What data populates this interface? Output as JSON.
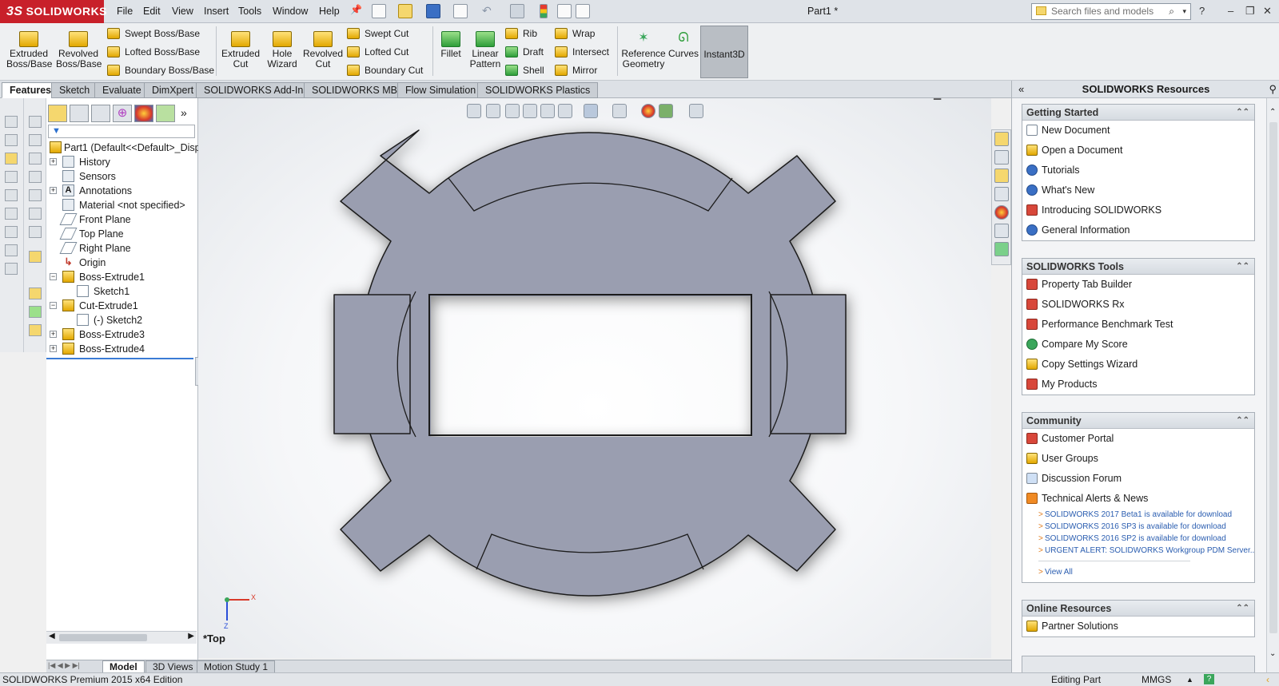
{
  "app": {
    "brand": "SOLIDWORKS",
    "brand_prefix": "3S",
    "doc_title": "Part1 *"
  },
  "menu": [
    "File",
    "Edit",
    "View",
    "Insert",
    "Tools",
    "Window",
    "Help"
  ],
  "search": {
    "placeholder": "Search files and models"
  },
  "window_buttons": {
    "help": "?",
    "minimize": "–",
    "restore": "❐",
    "close": "✕"
  },
  "ribbon": {
    "extruded_boss": "Extruded Boss/Base",
    "revolved_boss": "Revolved Boss/Base",
    "swept_boss": "Swept Boss/Base",
    "lofted_boss": "Lofted Boss/Base",
    "boundary_boss": "Boundary Boss/Base",
    "extruded_cut": "Extruded Cut",
    "hole_wizard": "Hole Wizard",
    "revolved_cut": "Revolved Cut",
    "swept_cut": "Swept Cut",
    "lofted_cut": "Lofted Cut",
    "boundary_cut": "Boundary Cut",
    "fillet": "Fillet",
    "linear_pattern": "Linear Pattern",
    "rib": "Rib",
    "draft": "Draft",
    "shell": "Shell",
    "wrap": "Wrap",
    "intersect": "Intersect",
    "mirror": "Mirror",
    "reference_geometry": "Reference Geometry",
    "curves": "Curves",
    "instant3d": "Instant3D"
  },
  "tabs": [
    "Features",
    "Sketch",
    "Evaluate",
    "DimXpert",
    "SOLIDWORKS Add-Ins",
    "SOLIDWORKS MBD",
    "Flow Simulation",
    "SOLIDWORKS Plastics"
  ],
  "tree": {
    "root": "Part1  (Default<<Default>_Disp",
    "items": [
      {
        "label": "History"
      },
      {
        "label": "Sensors"
      },
      {
        "label": "Annotations"
      },
      {
        "label": "Material <not specified>"
      },
      {
        "label": "Front Plane"
      },
      {
        "label": "Top Plane"
      },
      {
        "label": "Right Plane"
      },
      {
        "label": "Origin"
      },
      {
        "label": "Boss-Extrude1"
      },
      {
        "label": "Sketch1"
      },
      {
        "label": "Cut-Extrude1"
      },
      {
        "label": "(-) Sketch2"
      },
      {
        "label": "Boss-Extrude3"
      },
      {
        "label": "Boss-Extrude4"
      }
    ]
  },
  "view": {
    "label": "*Top",
    "triad_x": "X",
    "triad_z": "Z"
  },
  "bottom_tabs": [
    "Model",
    "3D Views",
    "Motion Study 1"
  ],
  "status": {
    "edition": "SOLIDWORKS Premium 2015 x64 Edition",
    "mode": "Editing Part",
    "units": "MMGS"
  },
  "resources": {
    "title": "SOLIDWORKS Resources",
    "getting_started": {
      "title": "Getting Started",
      "items": [
        "New Document",
        "Open a Document",
        "Tutorials",
        "What's New",
        "Introducing SOLIDWORKS",
        "General Information"
      ]
    },
    "tools": {
      "title": "SOLIDWORKS Tools",
      "items": [
        "Property Tab Builder",
        "SOLIDWORKS Rx",
        "Performance Benchmark Test",
        "Compare My Score",
        "Copy Settings Wizard",
        "My Products"
      ]
    },
    "community": {
      "title": "Community",
      "items": [
        "Customer Portal",
        "User Groups",
        "Discussion Forum",
        "Technical Alerts & News"
      ],
      "news": [
        "SOLIDWORKS 2017 Beta1 is available for download",
        "SOLIDWORKS 2016 SP3 is available for download",
        "SOLIDWORKS 2016 SP2 is available for download",
        "URGENT ALERT: SOLIDWORKS Workgroup PDM Server..."
      ],
      "view_all": "View All"
    },
    "online": {
      "title": "Online Resources",
      "items": [
        "Partner Solutions"
      ]
    }
  },
  "colors": {
    "part_fill": "#9ca0b2",
    "brand_red": "#c8202a",
    "link_blue": "#2a5db0"
  }
}
